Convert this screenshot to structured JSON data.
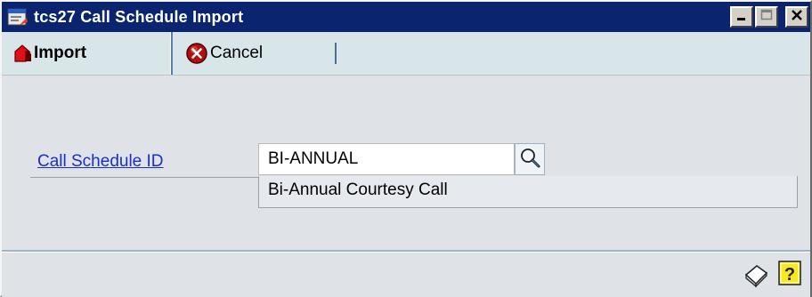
{
  "window": {
    "title": "tcs27 Call Schedule Import"
  },
  "toolbar": {
    "import_label": "Import",
    "cancel_label": "Cancel"
  },
  "form": {
    "call_schedule_id_label": "Call Schedule ID",
    "call_schedule_id_value": "BI-ANNUAL",
    "description_value": "Bi-Annual Courtesy Call"
  },
  "icons": {
    "window_icon": "window-app-icon",
    "import_icon": "import-arrow-icon",
    "cancel_icon": "cancel-x-icon",
    "lookup_icon": "magnifier-icon",
    "note_icon": "note-icon",
    "help_icon": "help-question-icon",
    "minimize_icon": "minimize-icon",
    "maximize_icon": "maximize-icon",
    "close_icon": "close-icon"
  },
  "colors": {
    "title_bar": "#0a2470",
    "toolbar": "#d9e6e9",
    "link": "#1a2ec8",
    "cancel_icon": "#b01010"
  }
}
